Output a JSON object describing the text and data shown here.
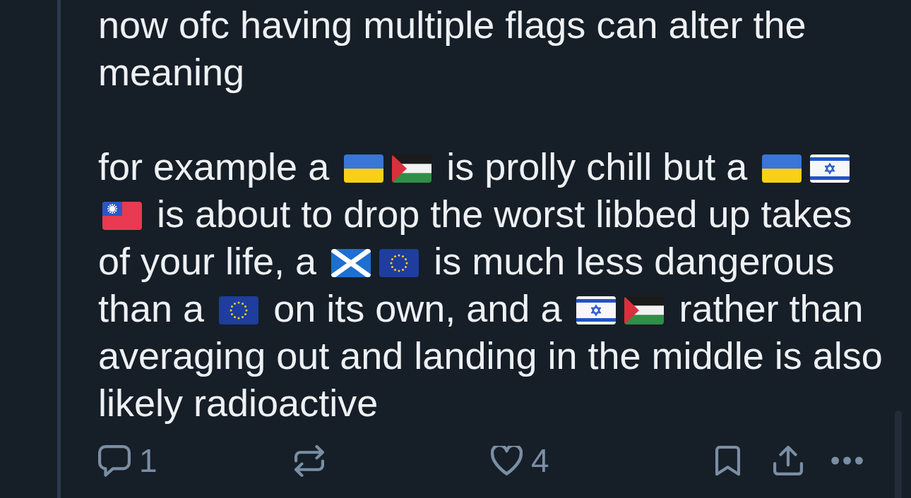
{
  "post": {
    "paragraphs": [
      {
        "segments": [
          {
            "kind": "text",
            "text": "now ofc having multiple flags can alter the meaning"
          }
        ]
      },
      {
        "segments": [
          {
            "kind": "text",
            "text": "for example a"
          },
          {
            "kind": "ukraine"
          },
          {
            "kind": "palestine"
          },
          {
            "kind": "text",
            "text": "is prolly chill but a"
          },
          {
            "kind": "ukraine"
          },
          {
            "kind": "israel"
          },
          {
            "kind": "taiwan"
          },
          {
            "kind": "text",
            "text": "is about to drop the worst libbed up takes of your life, a"
          },
          {
            "kind": "scotland"
          },
          {
            "kind": "eu"
          },
          {
            "kind": "text",
            "text": "is much less dangerous than a"
          },
          {
            "kind": "eu"
          },
          {
            "kind": "text",
            "text": "on its own, and a"
          },
          {
            "kind": "israel"
          },
          {
            "kind": "palestine"
          },
          {
            "kind": "text",
            "text": "rather than averaging out and landing in the middle is also likely radioactive"
          }
        ]
      }
    ]
  },
  "actions": [
    {
      "kind": "reply",
      "count": "1"
    },
    {
      "kind": "repost"
    },
    {
      "kind": "like",
      "count": "4"
    },
    {
      "kind": "bookmark"
    },
    {
      "kind": "share"
    },
    {
      "kind": "more"
    }
  ]
}
